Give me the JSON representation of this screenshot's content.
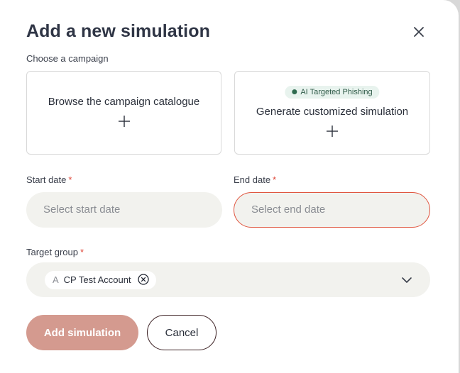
{
  "dialog": {
    "title": "Add a new simulation",
    "close_icon": "close-icon"
  },
  "campaign": {
    "label": "Choose a campaign",
    "options": [
      {
        "title": "Browse the campaign catalogue",
        "icon": "plus-icon"
      },
      {
        "badge": "AI Targeted Phishing",
        "title": "Generate customized simulation",
        "icon": "plus-icon"
      }
    ]
  },
  "start_date": {
    "label": "Start date",
    "required_mark": "*",
    "placeholder": "Select start date"
  },
  "end_date": {
    "label": "End date",
    "required_mark": "*",
    "placeholder": "Select end date",
    "border_color": "#e0553f"
  },
  "target_group": {
    "label": "Target group",
    "required_mark": "*",
    "selected": [
      {
        "icon": "A",
        "label": "CP Test Account"
      }
    ],
    "dropdown_icon": "chevron-down-icon"
  },
  "actions": {
    "primary_label": "Add simulation",
    "secondary_label": "Cancel",
    "primary_color": "#d49a8f"
  }
}
